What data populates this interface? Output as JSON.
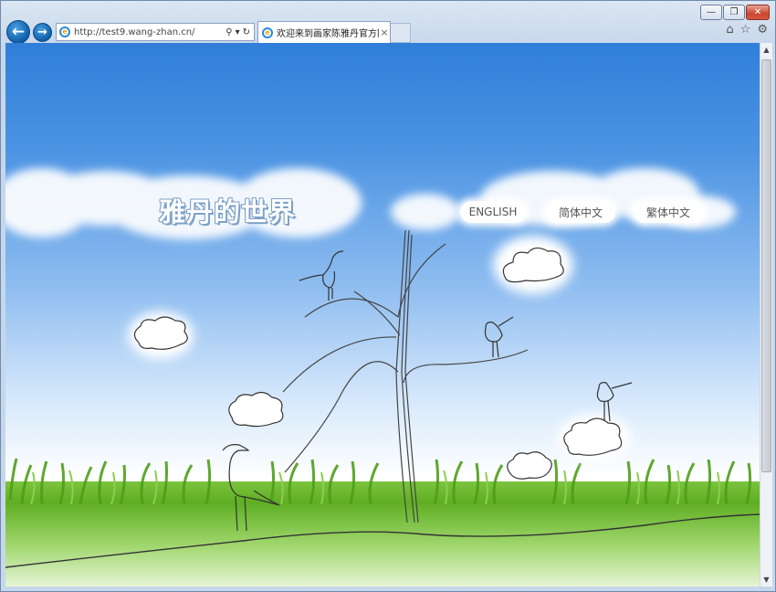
{
  "browser": {
    "address_url": "http://test9.wang-zhan.cn/",
    "tab_title": "欢迎来到画家陈雅丹官方网...",
    "tab_close": "×",
    "back_glyph": "←",
    "forward_glyph": "→",
    "window_controls": [
      "minimize-icon",
      "restore-icon",
      "close-icon"
    ],
    "toolbar_icons": [
      "home-icon",
      "favorites-star-icon",
      "settings-gear-icon"
    ],
    "colors": {
      "nav_button": "#1469b6",
      "close_button": "#c9472f"
    }
  },
  "site": {
    "title": "雅丹的世界",
    "languages": [
      "ENGLISH",
      "简体中文",
      "繁体中文"
    ],
    "colors": {
      "sky_top": "#2f7fda",
      "grass": "#5eae22"
    }
  }
}
